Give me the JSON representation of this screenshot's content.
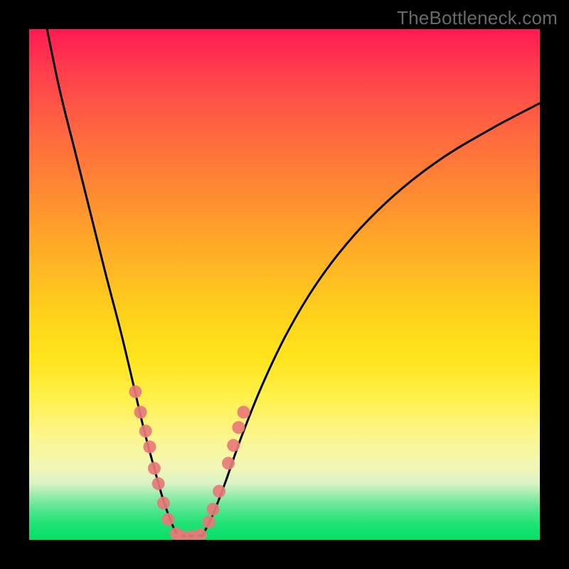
{
  "watermark": "TheBottleneck.com",
  "chart_data": {
    "type": "line",
    "title": "",
    "xlabel": "",
    "ylabel": "",
    "xlim": [
      0,
      1
    ],
    "ylim": [
      0,
      1
    ],
    "legend": false,
    "grid": false,
    "background_gradient": {
      "direction": "vertical",
      "stops": [
        {
          "pos": 0.0,
          "color": "#ff1a53"
        },
        {
          "pos": 0.2,
          "color": "#ff6740"
        },
        {
          "pos": 0.44,
          "color": "#ffaf26"
        },
        {
          "pos": 0.64,
          "color": "#ffe41a"
        },
        {
          "pos": 0.8,
          "color": "#fbf68f"
        },
        {
          "pos": 0.9,
          "color": "#a0ecb0"
        },
        {
          "pos": 1.0,
          "color": "#08df66"
        }
      ]
    },
    "series": [
      {
        "name": "left-branch",
        "kind": "curve",
        "stroke": "#000000",
        "stroke_width": 3,
        "x": [
          0.035,
          0.06,
          0.09,
          0.12,
          0.15,
          0.18,
          0.205,
          0.225,
          0.245,
          0.262,
          0.278,
          0.29
        ],
        "y": [
          1.0,
          0.88,
          0.76,
          0.64,
          0.52,
          0.405,
          0.3,
          0.215,
          0.14,
          0.08,
          0.035,
          0.01
        ]
      },
      {
        "name": "right-branch",
        "kind": "curve",
        "stroke": "#000000",
        "stroke_width": 3,
        "x": [
          0.34,
          0.36,
          0.385,
          0.415,
          0.455,
          0.505,
          0.565,
          0.635,
          0.715,
          0.805,
          0.905,
          1.0
        ],
        "y": [
          0.01,
          0.05,
          0.115,
          0.2,
          0.3,
          0.405,
          0.505,
          0.595,
          0.675,
          0.745,
          0.805,
          0.855
        ]
      },
      {
        "name": "valley-floor",
        "kind": "line",
        "stroke": "#000000",
        "stroke_width": 3,
        "x": [
          0.29,
          0.34
        ],
        "y": [
          0.008,
          0.008
        ]
      },
      {
        "name": "markers-left",
        "kind": "scatter",
        "color": "#e77a7a",
        "radius": 9,
        "x": [
          0.208,
          0.218,
          0.228,
          0.236,
          0.245,
          0.253,
          0.263,
          0.272
        ],
        "y": [
          0.29,
          0.25,
          0.213,
          0.182,
          0.14,
          0.11,
          0.072,
          0.04
        ]
      },
      {
        "name": "markers-bottom",
        "kind": "scatter",
        "color": "#e77a7a",
        "radius": 9,
        "x": [
          0.288,
          0.3,
          0.318,
          0.335
        ],
        "y": [
          0.012,
          0.006,
          0.006,
          0.01
        ]
      },
      {
        "name": "markers-right",
        "kind": "scatter",
        "color": "#e77a7a",
        "radius": 9,
        "x": [
          0.352,
          0.36,
          0.372,
          0.39,
          0.4,
          0.41,
          0.42
        ],
        "y": [
          0.035,
          0.06,
          0.095,
          0.15,
          0.185,
          0.22,
          0.25
        ]
      }
    ]
  }
}
